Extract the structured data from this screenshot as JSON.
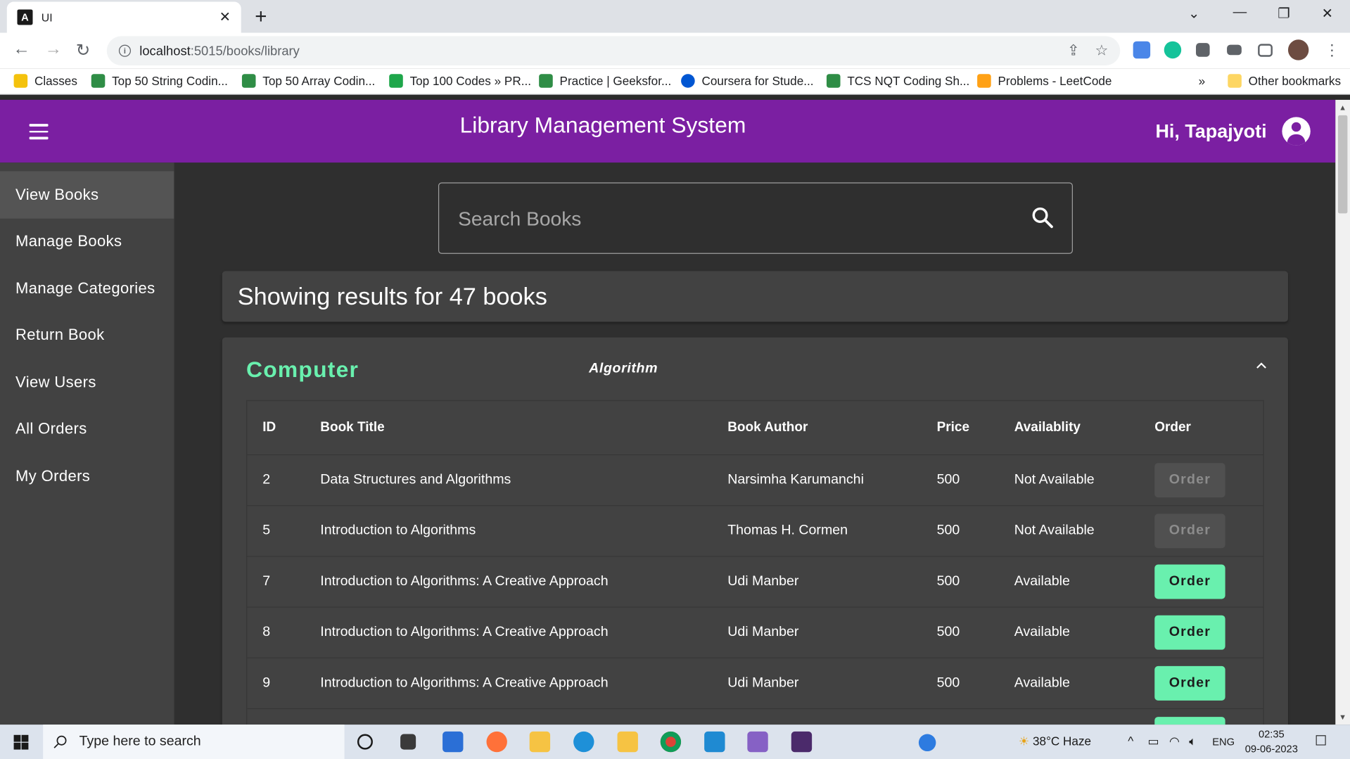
{
  "browser": {
    "tab_title": "UI",
    "url_host": "localhost",
    "url_path": ":5015/books/library",
    "bookmarks": [
      "Classes",
      "Top 50 String Codin...",
      "Top 50 Array Codin...",
      "Top 100 Codes » PR...",
      "Practice | Geeksfor...",
      "Coursera for Stude...",
      "TCS NQT Coding Sh...",
      "Problems - LeetCode"
    ],
    "bookmarks_overflow": "»",
    "other_bookmarks": "Other bookmarks"
  },
  "header": {
    "title": "Library Management System",
    "greeting": "Hi, Tapajyoti"
  },
  "sidebar": {
    "items": [
      {
        "label": "View Books"
      },
      {
        "label": "Manage Books"
      },
      {
        "label": "Manage Categories"
      },
      {
        "label": "Return Book"
      },
      {
        "label": "View Users"
      },
      {
        "label": "All Orders"
      },
      {
        "label": "My Orders"
      }
    ],
    "active": "View Books"
  },
  "search": {
    "placeholder": "Search Books",
    "value": ""
  },
  "results": {
    "text": "Showing results for 47 books"
  },
  "panel": {
    "category": "Computer",
    "subcategory": "Algorithm",
    "columns": [
      "ID",
      "Book Title",
      "Book Author",
      "Price",
      "Availablity",
      "Order"
    ],
    "rows": [
      {
        "id": "2",
        "title": "Data Structures and Algorithms",
        "author": "Narsimha Karumanchi",
        "price": "500",
        "availability": "Not Available",
        "order": "Order",
        "enabled": false
      },
      {
        "id": "5",
        "title": "Introduction to Algorithms",
        "author": "Thomas H. Cormen",
        "price": "500",
        "availability": "Not Available",
        "order": "Order",
        "enabled": false
      },
      {
        "id": "7",
        "title": "Introduction to Algorithms: A Creative Approach",
        "author": "Udi Manber",
        "price": "500",
        "availability": "Available",
        "order": "Order",
        "enabled": true
      },
      {
        "id": "8",
        "title": "Introduction to Algorithms: A Creative Approach",
        "author": "Udi Manber",
        "price": "500",
        "availability": "Available",
        "order": "Order",
        "enabled": true
      },
      {
        "id": "9",
        "title": "Introduction to Algorithms: A Creative Approach",
        "author": "Udi Manber",
        "price": "500",
        "availability": "Available",
        "order": "Order",
        "enabled": true
      }
    ]
  },
  "taskbar": {
    "search_placeholder": "Type here to search",
    "weather": "38°C  Haze",
    "language": "ENG",
    "time": "02:35",
    "date": "09-06-2023"
  },
  "colors": {
    "header": "#7b1fa2",
    "accent": "#69f0ae",
    "sidebar": "#424242",
    "main_bg": "#2f2f2f"
  }
}
